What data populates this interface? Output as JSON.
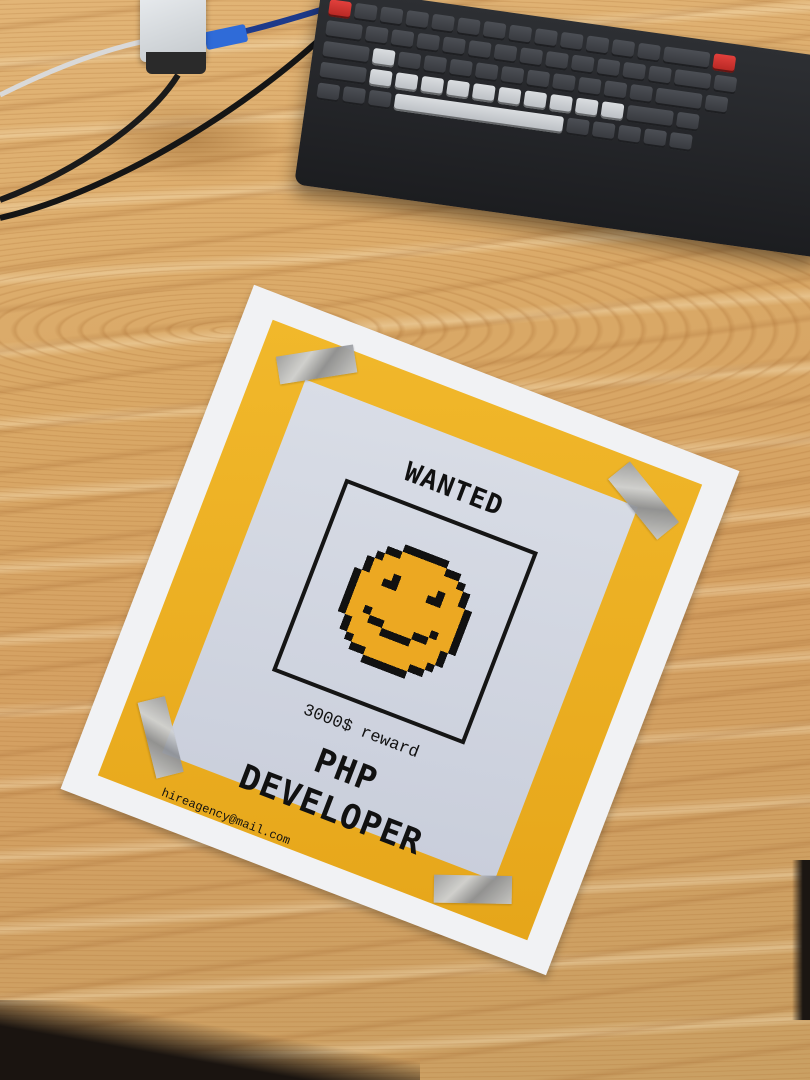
{
  "scene": {
    "objects": [
      "poster-icon",
      "keyboard-icon",
      "usb-hub-icon",
      "cable-icon",
      "tape-icon"
    ]
  },
  "poster": {
    "title": "WANTED",
    "reward": "3000$ reward",
    "headline_line1": "PHP",
    "headline_line2": "DEVELOPER",
    "email": "hireagency@mail.com",
    "colors": {
      "background": "#e9ab1f",
      "panel": "#d2d6e0",
      "ink": "#111111",
      "paper": "#f1f2f4"
    }
  },
  "desk": {
    "colors": {
      "wood": "#d9a866"
    }
  }
}
